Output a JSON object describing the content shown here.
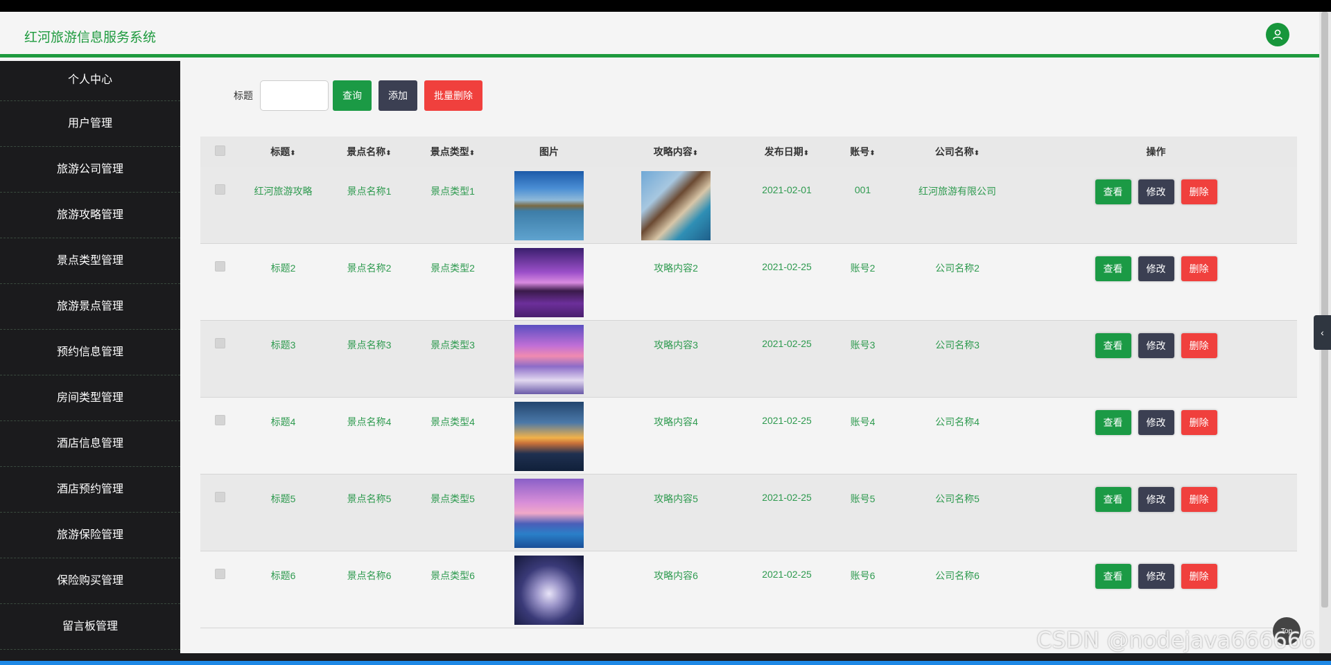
{
  "app": {
    "title": "红河旅游信息服务系统"
  },
  "sidebar": {
    "items": [
      {
        "label": "个人中心"
      },
      {
        "label": "用户管理"
      },
      {
        "label": "旅游公司管理"
      },
      {
        "label": "旅游攻略管理"
      },
      {
        "label": "景点类型管理"
      },
      {
        "label": "旅游景点管理"
      },
      {
        "label": "预约信息管理"
      },
      {
        "label": "房间类型管理"
      },
      {
        "label": "酒店信息管理"
      },
      {
        "label": "酒店预约管理"
      },
      {
        "label": "旅游保险管理"
      },
      {
        "label": "保险购买管理"
      },
      {
        "label": "留言板管理"
      }
    ]
  },
  "search": {
    "label": "标题",
    "value": "",
    "query_button": "查询",
    "add_button": "添加",
    "batch_delete_button": "批量删除"
  },
  "table": {
    "headers": {
      "title": "标题",
      "spot_name": "景点名称",
      "spot_type": "景点类型",
      "image": "图片",
      "guide_content": "攻略内容",
      "publish_date": "发布日期",
      "account": "账号",
      "company": "公司名称",
      "ops": "操作"
    },
    "sort_glyph": "⬍",
    "rows": [
      {
        "title": "红河旅游攻略",
        "spot_name": "景点名称1",
        "spot_type": "景点类型1",
        "image": "lake-landscape",
        "guide_content": "",
        "guide_image": "resort-pool",
        "publish_date": "2021-02-01",
        "account": "001",
        "company": "红河旅游有限公司"
      },
      {
        "title": "标题2",
        "spot_name": "景点名称2",
        "spot_type": "景点类型2",
        "image": "purple-island",
        "guide_content": "攻略内容2",
        "publish_date": "2021-02-25",
        "account": "账号2",
        "company": "公司名称2"
      },
      {
        "title": "标题3",
        "spot_name": "景点名称3",
        "spot_type": "景点类型3",
        "image": "pink-sky-snow",
        "guide_content": "攻略内容3",
        "publish_date": "2021-02-25",
        "account": "账号3",
        "company": "公司名称3"
      },
      {
        "title": "标题4",
        "spot_name": "景点名称4",
        "spot_type": "景点类型4",
        "image": "sunset-pier",
        "guide_content": "攻略内容4",
        "publish_date": "2021-02-25",
        "account": "账号4",
        "company": "公司名称4"
      },
      {
        "title": "标题5",
        "spot_name": "景点名称5",
        "spot_type": "景点类型5",
        "image": "palm-sunset-pool",
        "guide_content": "攻略内容5",
        "publish_date": "2021-02-25",
        "account": "账号5",
        "company": "公司名称5"
      },
      {
        "title": "标题6",
        "spot_name": "景点名称6",
        "spot_type": "景点类型6",
        "image": "night-glow",
        "guide_content": "攻略内容6",
        "publish_date": "2021-02-25",
        "account": "账号6",
        "company": "公司名称6"
      }
    ],
    "row_actions": {
      "view": "查看",
      "edit": "修改",
      "delete": "删除"
    }
  },
  "floating": {
    "top_button": "Top",
    "watermark": "CSDN @nodejava666666"
  },
  "colors": {
    "accent": "#1e9a3e",
    "sidebar_bg": "#1b1b1d",
    "danger": "#f0403d",
    "dark_button": "#3b3f52"
  }
}
